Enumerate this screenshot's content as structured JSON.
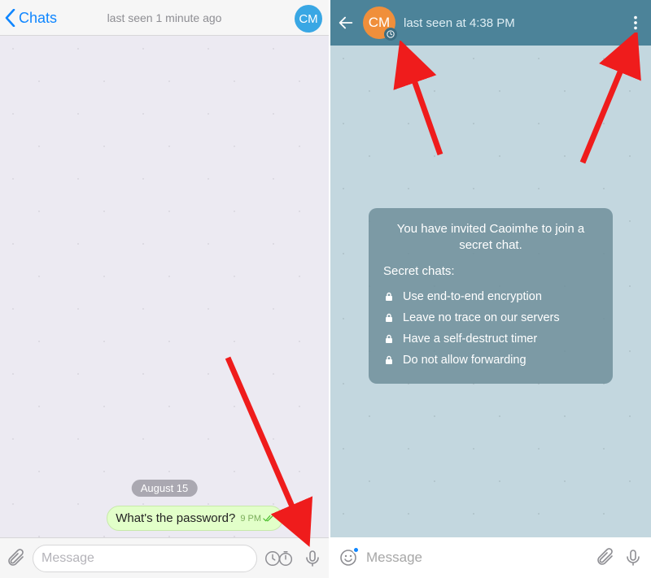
{
  "left": {
    "back_label": "Chats",
    "status": "last seen 1 minute ago",
    "avatar": "CM",
    "date_pill": "August 15",
    "message_text": "What's the password?",
    "message_time": "9 PM",
    "input_placeholder": "Message"
  },
  "right": {
    "avatar": "CM",
    "status": "last seen at 4:38 PM",
    "secret_intro": "You have invited Caoimhe to join a secret chat.",
    "secret_heading": "Secret chats:",
    "bullets": [
      "Use end-to-end encryption",
      "Leave no trace on our servers",
      "Have a self-destruct timer",
      "Do not allow forwarding"
    ],
    "input_placeholder": "Message"
  }
}
